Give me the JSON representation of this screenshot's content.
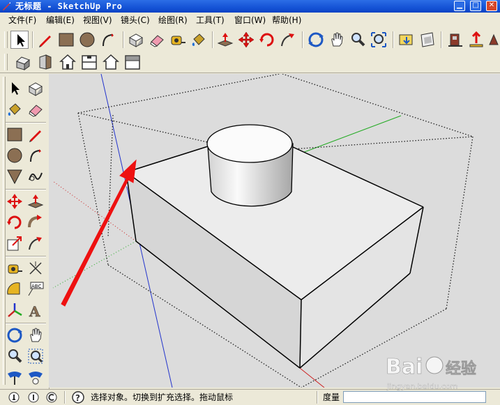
{
  "window": {
    "title": "无标题 - SketchUp Pro",
    "controls": [
      "minimize",
      "maximize",
      "close"
    ]
  },
  "menu": [
    {
      "label": "文件(F)"
    },
    {
      "label": "编辑(E)"
    },
    {
      "label": "视图(V)"
    },
    {
      "label": "镜头(C)"
    },
    {
      "label": "绘图(R)"
    },
    {
      "label": "工具(T)"
    },
    {
      "label": "窗口(W)"
    },
    {
      "label": "帮助(H)"
    }
  ],
  "toolbar_main": [
    "select-tool",
    "pencil-tool",
    "rectangle-tool",
    "circle-tool",
    "arc-tool",
    "make-component-tool",
    "eraser-tool",
    "tape-measure-tool",
    "paint-bucket-tool",
    "push-pull-tool",
    "move-tool",
    "rotate-tool",
    "follow-me-tool",
    "orbit-tool",
    "pan-tool",
    "zoom-tool",
    "zoom-extents-tool",
    "previous-view-tool",
    "section-plane-tool",
    "get-models-tool",
    "share-model-tool"
  ],
  "toolbar_views": [
    "iso-view",
    "front-view",
    "top-view",
    "left-view",
    "back-view",
    "right-view"
  ],
  "toolbar_left": [
    "select",
    "make-component",
    "paint-bucket",
    "eraser",
    "rectangle",
    "line",
    "circle",
    "arc",
    "polygon",
    "freehand",
    "move",
    "push-pull",
    "rotate",
    "follow-me",
    "scale",
    "offset",
    "tape-measure",
    "dimension",
    "protractor",
    "text",
    "axes",
    "3d-text",
    "orbit",
    "pan",
    "zoom",
    "zoom-window",
    "position-camera",
    "look-around"
  ],
  "colors": {
    "axis_red": "#cc2222",
    "axis_green": "#22aa22",
    "axis_blue": "#2233cc",
    "arrow": "#ee1111",
    "viewport_bg": "#dcdcdc"
  },
  "status": {
    "text": "选择对象。切换到扩充选择。拖动鼠标",
    "measure_label": "度量",
    "measure_value": ""
  },
  "watermark": {
    "brand": "Bai",
    "brand2": "经验",
    "url": "jingyan.baidu.com"
  }
}
